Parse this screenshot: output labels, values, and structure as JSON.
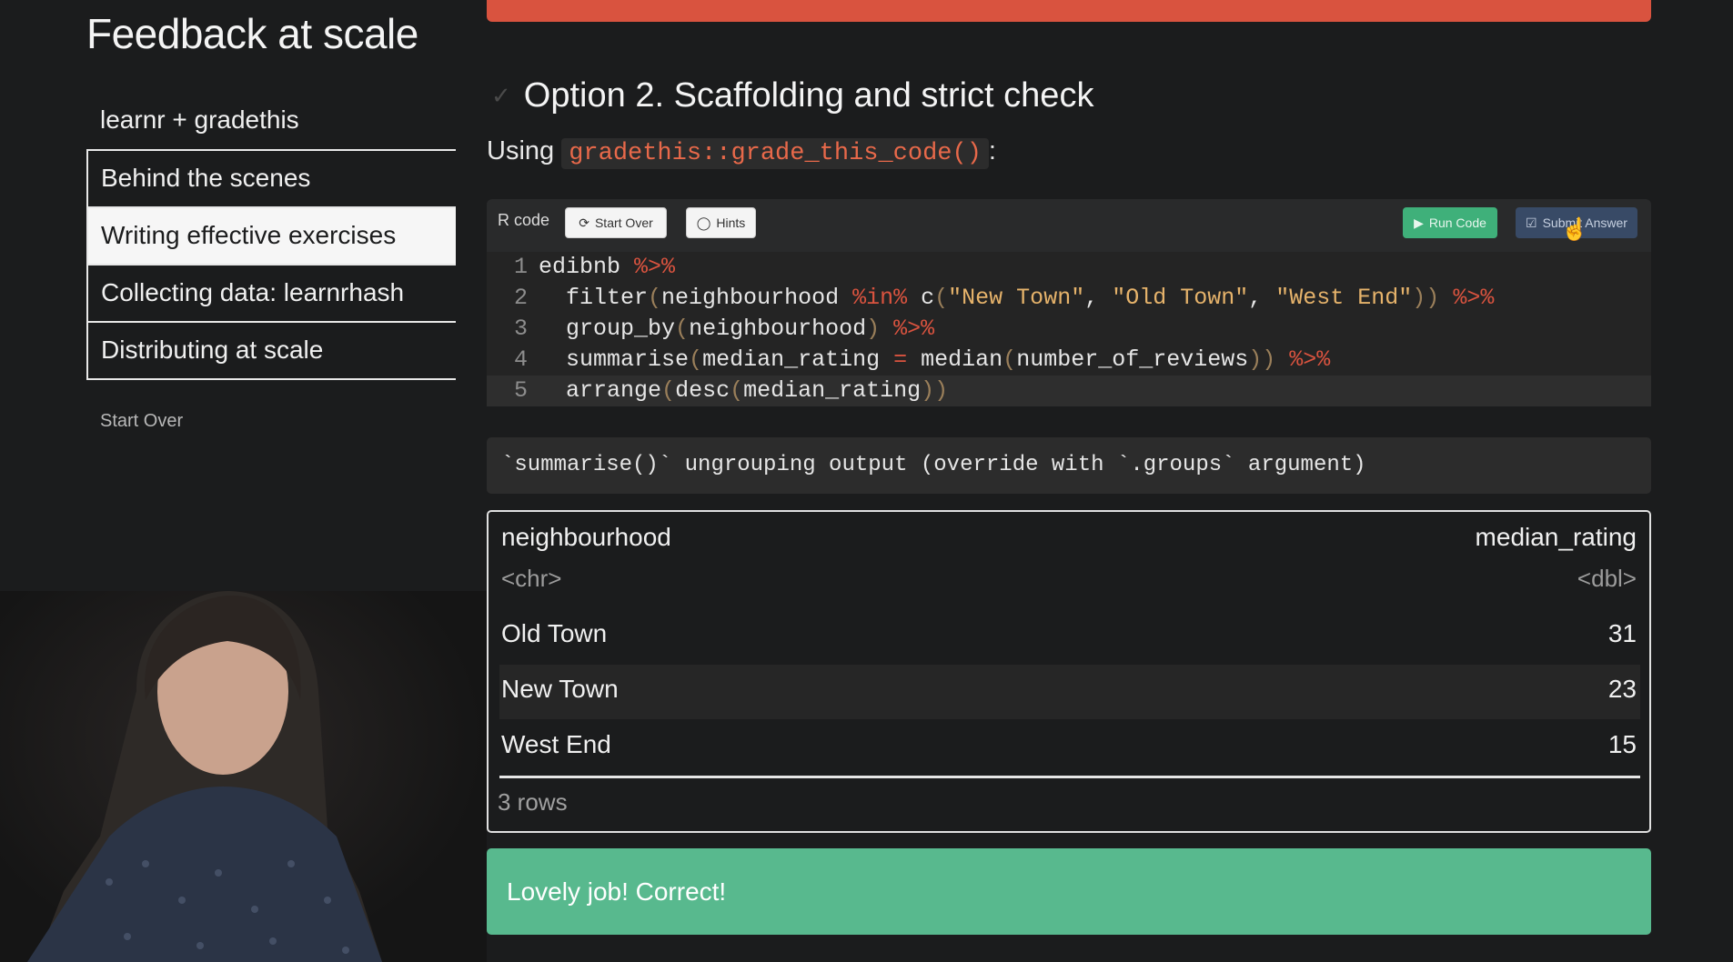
{
  "app_title": "Feedback at scale",
  "nav": {
    "top_item": "learnr + gradethis",
    "items": [
      {
        "label": "Behind the scenes",
        "active": false
      },
      {
        "label": "Writing effective exercises",
        "active": true
      },
      {
        "label": "Collecting data: learnrhash",
        "active": false
      },
      {
        "label": "Distributing at scale",
        "active": false
      }
    ],
    "start_over": "Start Over"
  },
  "section": {
    "check_icon": "✓",
    "heading": "Option 2. Scaffolding and strict check",
    "using_prefix": "Using",
    "using_code": "gradethis::grade_this_code()",
    "using_suffix": ":"
  },
  "exercise": {
    "label": "R code",
    "start_over_label": "Start Over",
    "hints_label": "Hints",
    "run_label": "Run Code",
    "submit_label": "Submit Answer",
    "code_lines": [
      {
        "num": "1"
      },
      {
        "num": "2"
      },
      {
        "num": "3"
      },
      {
        "num": "4"
      },
      {
        "num": "5"
      }
    ],
    "code": {
      "l1_obj": "edibnb",
      "pipe": "%>%",
      "l2_fn": "filter",
      "l2_var": "neighbourhood",
      "l2_in": "%in%",
      "l2_c": "c",
      "str_new": "\"New Town\"",
      "str_old": "\"Old Town\"",
      "str_west": "\"West End\"",
      "l3_fn": "group_by",
      "l3_var": "neighbourhood",
      "l4_fn": "summarise",
      "l4_var": "median_rating",
      "l4_eq": "=",
      "l4_median": "median",
      "l4_arg": "number_of_reviews",
      "l5_fn": "arrange",
      "l5_desc": "desc",
      "l5_var": "median_rating"
    }
  },
  "message": "`summarise()` ungrouping output (override with `.groups` argument)",
  "table": {
    "col1": "neighbourhood",
    "col2": "median_rating",
    "col1_type": "<chr>",
    "col2_type": "<dbl>",
    "rows": [
      {
        "neighbourhood": "Old Town",
        "median_rating": "31"
      },
      {
        "neighbourhood": "New Town",
        "median_rating": "23"
      },
      {
        "neighbourhood": "West End",
        "median_rating": "15"
      }
    ],
    "footer": "3 rows"
  },
  "success_message": "Lovely job! Correct!",
  "colors": {
    "top_bar": "#d9533f",
    "run_button": "#3fb07a",
    "submit_button": "#384a66",
    "success": "#58b98e"
  }
}
